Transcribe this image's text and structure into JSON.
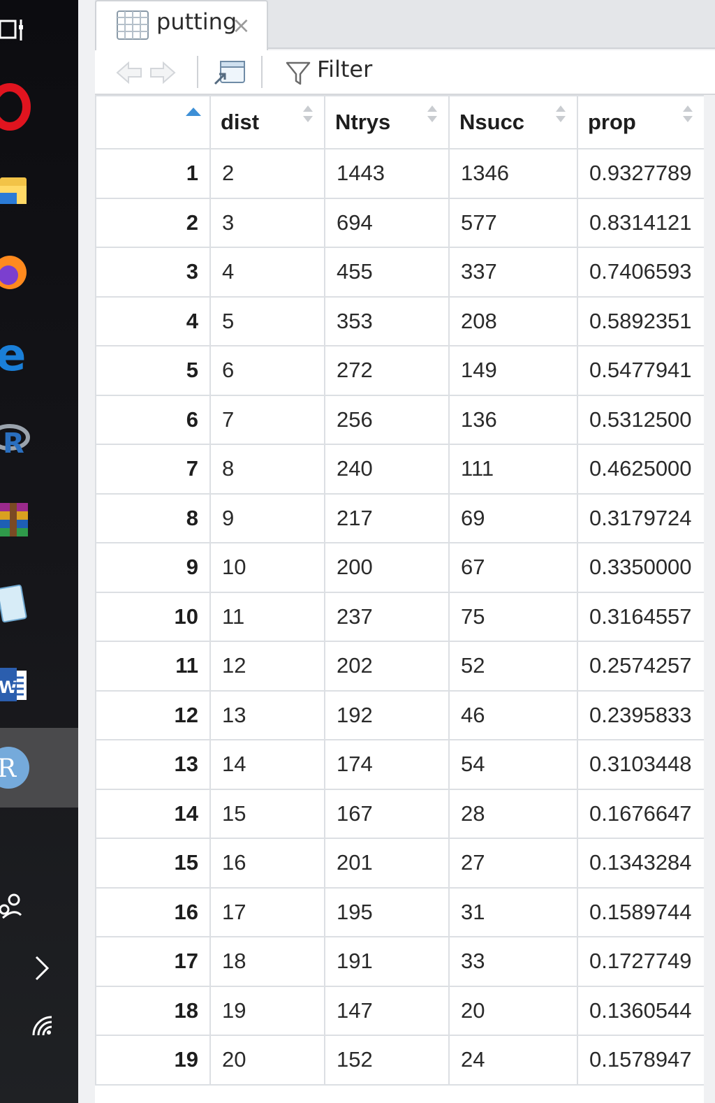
{
  "taskbar": {
    "icons": [
      "task-view-icon",
      "opera-icon",
      "file-explorer-icon",
      "firefox-icon",
      "edge-icon",
      "r-icon",
      "winrar-icon",
      "notepad-icon",
      "word-icon",
      "rstudio-icon",
      "people-icon",
      "chevron-right-icon",
      "wifi-icon"
    ],
    "active": "rstudio-icon"
  },
  "tab": {
    "title": "putting",
    "close": "×"
  },
  "toolbar": {
    "filter_label": "Filter"
  },
  "table": {
    "columns": [
      "dist",
      "Ntrys",
      "Nsucc",
      "prop"
    ],
    "sort_indicator": "ascending",
    "rows": [
      {
        "n": "1",
        "dist": "2",
        "ntrys": "1443",
        "nsucc": "1346",
        "prop": "0.9327789"
      },
      {
        "n": "2",
        "dist": "3",
        "ntrys": "694",
        "nsucc": "577",
        "prop": "0.8314121"
      },
      {
        "n": "3",
        "dist": "4",
        "ntrys": "455",
        "nsucc": "337",
        "prop": "0.7406593"
      },
      {
        "n": "4",
        "dist": "5",
        "ntrys": "353",
        "nsucc": "208",
        "prop": "0.5892351"
      },
      {
        "n": "5",
        "dist": "6",
        "ntrys": "272",
        "nsucc": "149",
        "prop": "0.5477941"
      },
      {
        "n": "6",
        "dist": "7",
        "ntrys": "256",
        "nsucc": "136",
        "prop": "0.5312500"
      },
      {
        "n": "7",
        "dist": "8",
        "ntrys": "240",
        "nsucc": "111",
        "prop": "0.4625000"
      },
      {
        "n": "8",
        "dist": "9",
        "ntrys": "217",
        "nsucc": "69",
        "prop": "0.3179724"
      },
      {
        "n": "9",
        "dist": "10",
        "ntrys": "200",
        "nsucc": "67",
        "prop": "0.3350000"
      },
      {
        "n": "10",
        "dist": "11",
        "ntrys": "237",
        "nsucc": "75",
        "prop": "0.3164557"
      },
      {
        "n": "11",
        "dist": "12",
        "ntrys": "202",
        "nsucc": "52",
        "prop": "0.2574257"
      },
      {
        "n": "12",
        "dist": "13",
        "ntrys": "192",
        "nsucc": "46",
        "prop": "0.2395833"
      },
      {
        "n": "13",
        "dist": "14",
        "ntrys": "174",
        "nsucc": "54",
        "prop": "0.3103448"
      },
      {
        "n": "14",
        "dist": "15",
        "ntrys": "167",
        "nsucc": "28",
        "prop": "0.1676647"
      },
      {
        "n": "15",
        "dist": "16",
        "ntrys": "201",
        "nsucc": "27",
        "prop": "0.1343284"
      },
      {
        "n": "16",
        "dist": "17",
        "ntrys": "195",
        "nsucc": "31",
        "prop": "0.1589744"
      },
      {
        "n": "17",
        "dist": "18",
        "ntrys": "191",
        "nsucc": "33",
        "prop": "0.1727749"
      },
      {
        "n": "18",
        "dist": "19",
        "ntrys": "147",
        "nsucc": "20",
        "prop": "0.1360544"
      },
      {
        "n": "19",
        "dist": "20",
        "ntrys": "152",
        "nsucc": "24",
        "prop": "0.1578947"
      }
    ]
  }
}
